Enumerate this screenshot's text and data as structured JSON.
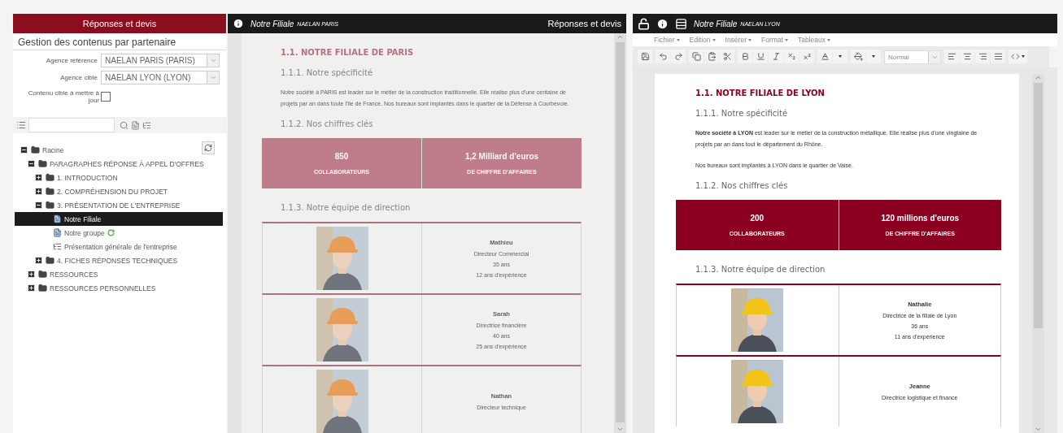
{
  "left_panel": {
    "header": "Réponses et devis",
    "title": "Gestion des contenus par partenaire",
    "fields": [
      {
        "label": "Agence référence",
        "value": "NAELAN PARIS (PARIS)"
      },
      {
        "label": "Agence cible",
        "value": "NAELAN LYON (LYON)"
      }
    ],
    "update_checkbox": {
      "label": "Contenu cible à mettre à jour",
      "checked": false
    },
    "tree": [
      {
        "label": "Racine",
        "kind": "folder",
        "expanded": true,
        "selected": false,
        "children": [
          {
            "label": "PARAGRAPHES RÉPONSE À APPEL D'OFFRES",
            "kind": "folder",
            "expanded": true,
            "selected": false,
            "children": [
              {
                "label": "1. INTRODUCTION",
                "kind": "folder",
                "expanded": false,
                "selected": false
              },
              {
                "label": "2. COMPRÉHENSION DU PROJET",
                "kind": "folder",
                "expanded": false,
                "selected": false
              },
              {
                "label": "3. PRÉSENTATION DE L'ENTREPRISE",
                "kind": "folder",
                "expanded": true,
                "selected": false,
                "children": [
                  {
                    "label": "Notre Filiale",
                    "kind": "document",
                    "selected": true,
                    "synced": false
                  },
                  {
                    "label": "Notre groupe",
                    "kind": "document",
                    "selected": false,
                    "synced": true
                  },
                  {
                    "label": "Présentation générale de l'entreprise",
                    "kind": "list",
                    "selected": false,
                    "synced": false
                  }
                ]
              },
              {
                "label": "4. FICHES RÉPONSES TECHNIQUES",
                "kind": "folder",
                "expanded": false,
                "selected": false
              }
            ]
          },
          {
            "label": "RESSOURCES",
            "kind": "folder",
            "expanded": false,
            "selected": false
          },
          {
            "label": "RESSOURCES PERSONNELLES",
            "kind": "folder",
            "expanded": false,
            "selected": false
          }
        ]
      }
    ]
  },
  "source_panel": {
    "title": "Notre Filiale",
    "subtitle": "NAELAN PARIS",
    "right_label": "Réponses et devis",
    "document": {
      "heading": "1.1. NOTRE FILIALE DE PARIS",
      "section_1": "1.1.1. Notre spécificité",
      "paragraphs": [
        "Notre société à PARIS est leader sur le métier de la construction traditionnelle. Elle réalise plus d'une centaine de projets par an dans toute l'Ile de France. Nos bureaux sont implantés dans le quartier de la Défense à Courbevoie."
      ],
      "section_2": "1.1.2. Nos chiffres clés",
      "figures": [
        {
          "value": "850",
          "label": "COLLABORATEURS"
        },
        {
          "value": "1,2 Milliard d'euros",
          "label": "DE CHIFFRE D'AFFAIRES"
        }
      ],
      "section_3": "1.1.3. Notre équipe de direction",
      "team": [
        {
          "name": "Mathieu",
          "role": "Directeur Commercial",
          "age": "35 ans",
          "experience": "12 ans d'expérience"
        },
        {
          "name": "Sarah",
          "role": "Directrice financière",
          "age": "40 ans",
          "experience": "25 ans d'expérience"
        },
        {
          "name": "Nathan",
          "role": "Directeur technique"
        }
      ]
    }
  },
  "target_panel": {
    "title": "Notre Filiale",
    "subtitle": "NAELAN LYON",
    "menu": [
      "Fichier",
      "Edition",
      "Insérer",
      "Format",
      "Tableaux"
    ],
    "style_select": "Normal",
    "document": {
      "heading": "1.1. NOTRE FILIALE DE LYON",
      "section_1": "1.1.1. Notre spécificité",
      "paragraphs": [
        "**Notre société à LYON** est leader sur le métier de la construction métallique. Elle réalise plus d'une vingtaine de projets par an dans tout le département du Rhône.",
        "Nos bureaux sont implantés à LYON dans le quartier de Vaise."
      ],
      "section_2": "1.1.2. Nos chiffres clés",
      "figures": [
        {
          "value": "200",
          "label": "COLLABORATEURS"
        },
        {
          "value": "120 millions d'euros",
          "label": "DE CHIFFRE D'AFFAIRES"
        }
      ],
      "section_3": "1.1.3. Notre équipe de direction",
      "team": [
        {
          "name": "Nathalie",
          "role": "Directrice de la filiale de Lyon",
          "age": "36 ans",
          "experience": "11 ans d'expérience"
        },
        {
          "name": "Jeanne",
          "role": "Directrice logistique et finance"
        }
      ]
    }
  }
}
